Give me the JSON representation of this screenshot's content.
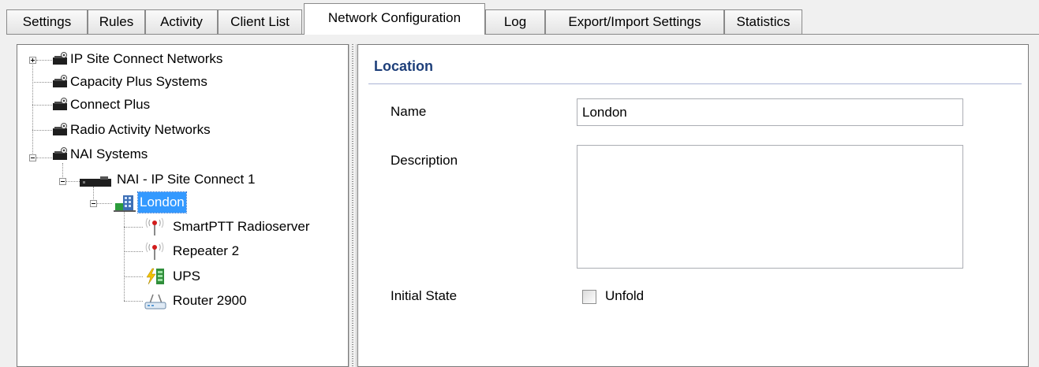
{
  "tabs": {
    "settings": "Settings",
    "rules": "Rules",
    "activity": "Activity",
    "client_list": "Client List",
    "network_configuration": "Network Configuration",
    "log": "Log",
    "export_import": "Export/Import Settings",
    "statistics": "Statistics",
    "active": "Network Configuration"
  },
  "tree": {
    "ip_site_connect": "IP Site Connect Networks",
    "capacity_plus": "Capacity Plus Systems",
    "connect_plus": "Connect Plus",
    "radio_activity": "Radio Activity Networks",
    "nai_systems": "NAI Systems",
    "nai_ip_site_connect_1": "NAI - IP Site Connect 1",
    "london": "London",
    "smartptt_radioserver": "SmartPTT Radioserver",
    "repeater_2": "Repeater 2",
    "ups": "UPS",
    "router_2900": "Router 2900",
    "selected": "London"
  },
  "properties": {
    "section_title": "Location",
    "name_label": "Name",
    "name_value": "London",
    "description_label": "Description",
    "description_value": "",
    "initial_state_label": "Initial State",
    "unfold_label": "Unfold",
    "unfold_checked": false
  },
  "colors": {
    "selection": "#3399ff",
    "section_title": "#1e3f7a"
  }
}
